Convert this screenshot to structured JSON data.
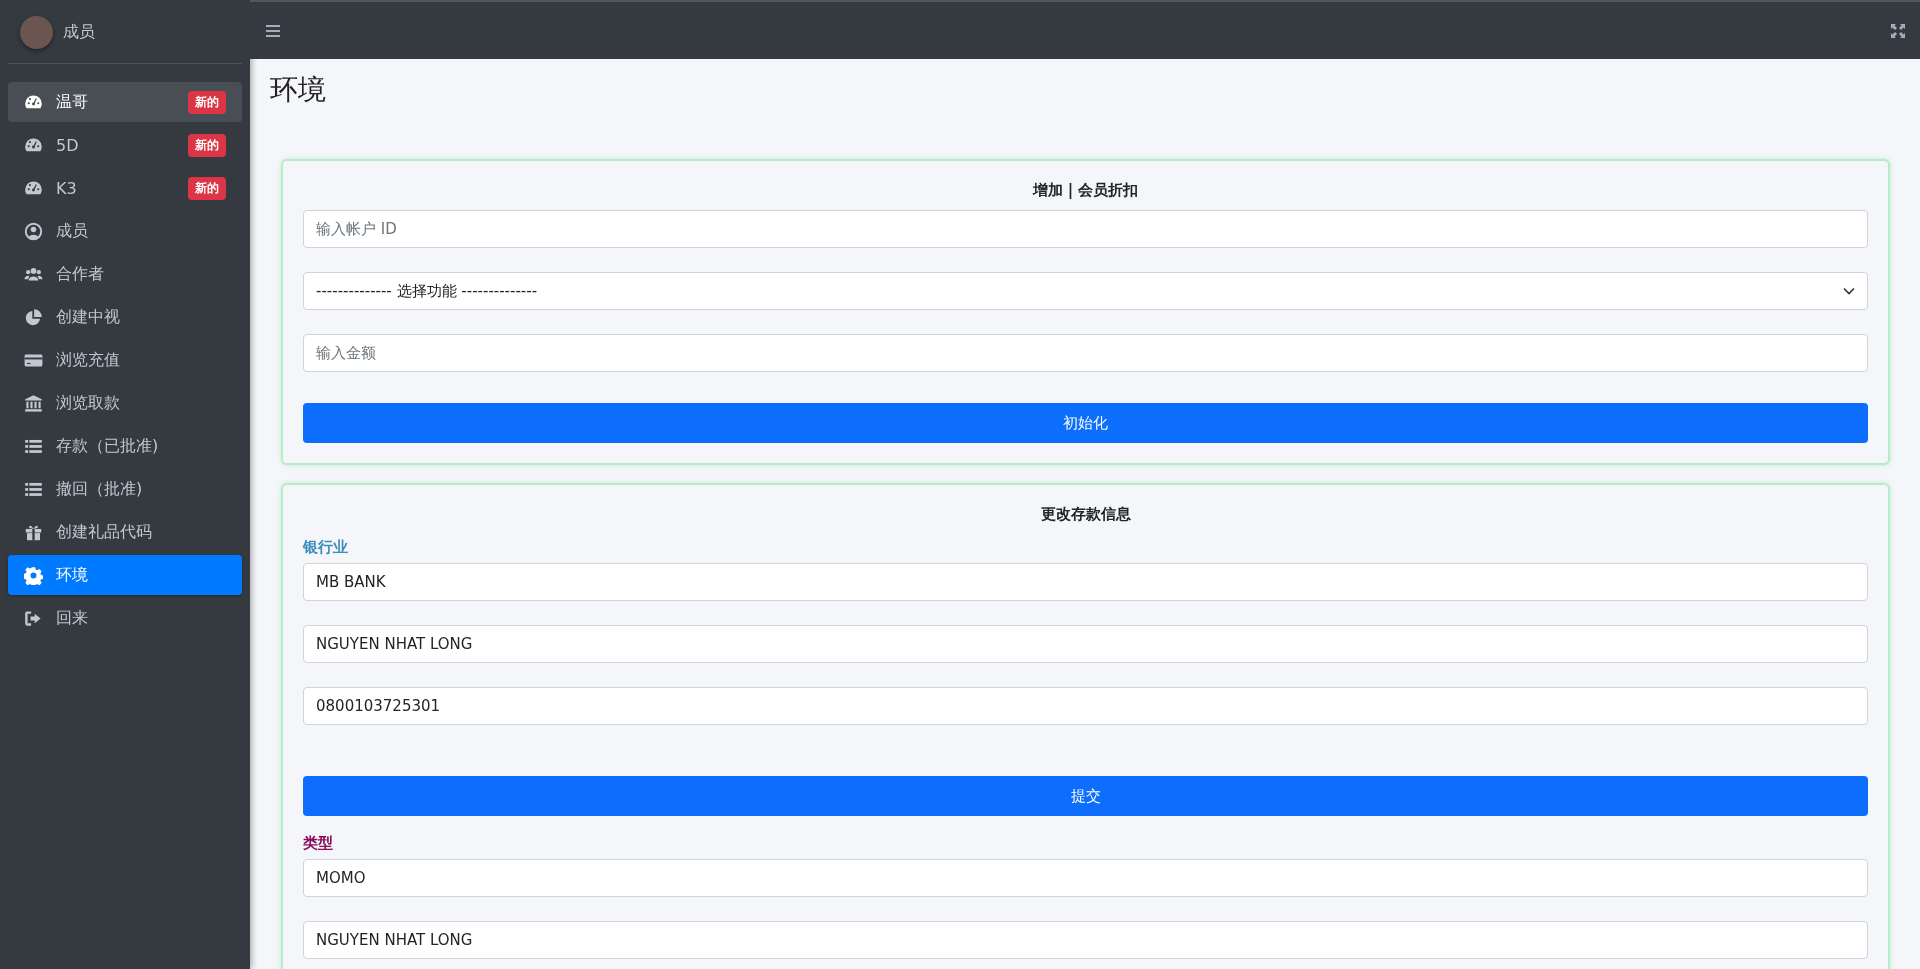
{
  "sidebar": {
    "user": {
      "name": "成员"
    },
    "items": [
      {
        "label": "温哥",
        "badge": "新的",
        "selected": false,
        "hover": true
      },
      {
        "label": "5D",
        "badge": "新的",
        "selected": false,
        "hover": false
      },
      {
        "label": "K3",
        "badge": "新的",
        "selected": false,
        "hover": false
      },
      {
        "label": "成员",
        "selected": false,
        "hover": false
      },
      {
        "label": "合作者",
        "selected": false,
        "hover": false
      },
      {
        "label": "创建中视",
        "selected": false,
        "hover": false
      },
      {
        "label": "浏览充值",
        "selected": false,
        "hover": false
      },
      {
        "label": "浏览取款",
        "selected": false,
        "hover": false
      },
      {
        "label": "存款（已批准)",
        "selected": false,
        "hover": false
      },
      {
        "label": "撤回（批准)",
        "selected": false,
        "hover": false
      },
      {
        "label": "创建礼品代码",
        "selected": false,
        "hover": false
      },
      {
        "label": "环境",
        "selected": true,
        "hover": false
      },
      {
        "label": "回来",
        "selected": false,
        "hover": false
      }
    ]
  },
  "page": {
    "title": "环境"
  },
  "cards": [
    {
      "title": "增加 | 会员折扣",
      "items": [
        {
          "kind": "input",
          "placeholder": "输入帐户 ID"
        },
        {
          "kind": "select",
          "value": "-------------- 选择功能 --------------"
        },
        {
          "kind": "input",
          "placeholder": "输入金额"
        },
        {
          "kind": "button",
          "label": "初始化"
        }
      ]
    },
    {
      "title": "更改存款信息",
      "items": [
        {
          "kind": "heading",
          "label": "银行业",
          "color": "#3c8dbc"
        },
        {
          "kind": "input",
          "value": "MB BANK"
        },
        {
          "kind": "input",
          "value": "NGUYEN NHAT LONG"
        },
        {
          "kind": "input",
          "value": "0800103725301"
        },
        {
          "kind": "spacer"
        },
        {
          "kind": "button",
          "label": "提交"
        },
        {
          "kind": "heading",
          "label": "类型",
          "color": "#8b0a5c"
        },
        {
          "kind": "input",
          "value": "MOMO"
        },
        {
          "kind": "input",
          "value": "NGUYEN NHAT LONG"
        }
      ]
    }
  ]
}
